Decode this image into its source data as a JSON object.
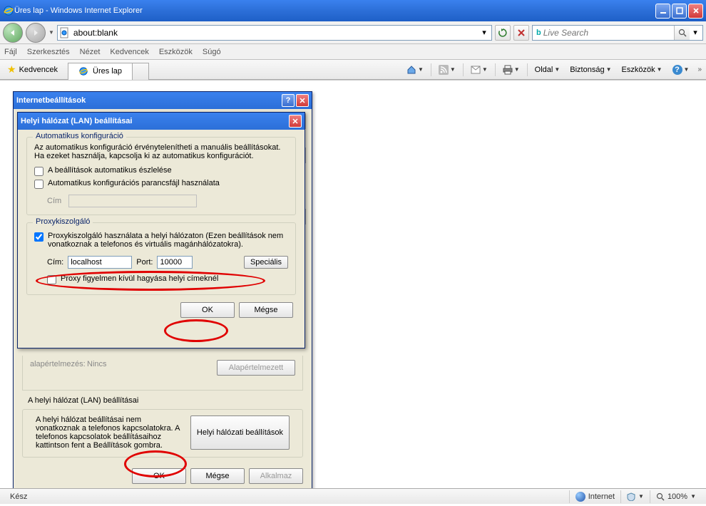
{
  "window": {
    "title": "Üres lap - Windows Internet Explorer"
  },
  "nav": {
    "address": "about:blank",
    "search_placeholder": "Live Search"
  },
  "menu": {
    "file": "Fájl",
    "edit": "Szerkesztés",
    "view": "Nézet",
    "favorites": "Kedvencek",
    "tools": "Eszközök",
    "help": "Súgó"
  },
  "favbar": {
    "favorites": "Kedvencek",
    "tab_title": "Üres lap",
    "page": "Oldal",
    "safety": "Biztonság",
    "tools": "Eszközök"
  },
  "parent_dialog": {
    "title": "Internetbeállítások",
    "setting_default_label": "alapértelmezés:",
    "setting_default_value": "Nincs",
    "reset_btn": "Alapértelmezett",
    "lan_section_title": "A helyi hálózat (LAN) beállításai",
    "lan_desc": "A helyi hálózat beállításai nem vonatkoznak a telefonos kapcsolatokra. A telefonos kapcsolatok beállításaihoz kattintson fent a Beállítások gombra.",
    "lan_btn": "Helyi hálózati beállítások",
    "ok": "OK",
    "cancel": "Mégse",
    "apply": "Alkalmaz"
  },
  "child_dialog": {
    "title": "Helyi hálózat (LAN) beállításai",
    "auto_group": {
      "legend": "Automatikus konfiguráció",
      "info": "Az automatikus konfiguráció érvénytelenítheti a manuális beállításokat. Ha ezeket használja, kapcsolja ki az automatikus konfigurációt.",
      "chk_detect": "A beállítások automatikus észlelése",
      "chk_script": "Automatikus konfigurációs parancsfájl használata",
      "addr_label": "Cím"
    },
    "proxy_group": {
      "legend": "Proxykiszolgáló",
      "chk_use": "Proxykiszolgáló használata a helyi hálózaton (Ezen beállítások nem vonatkoznak a telefonos és virtuális magánhálózatokra).",
      "addr_label": "Cím:",
      "addr_value": "localhost",
      "port_label": "Port:",
      "port_value": "10000",
      "special_btn": "Speciális",
      "chk_bypass": "Proxy figyelmen kívül hagyása helyi címeknél"
    },
    "ok": "OK",
    "cancel": "Mégse"
  },
  "status": {
    "ready": "Kész",
    "zone": "Internet",
    "zoom": "100%"
  }
}
